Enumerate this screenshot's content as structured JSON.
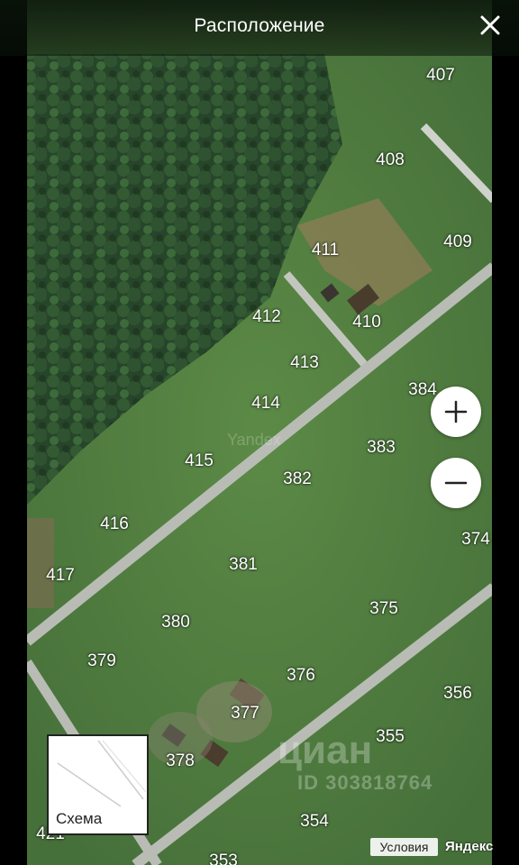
{
  "header": {
    "title": "Расположение",
    "close_icon": "close-icon"
  },
  "plots": [
    {
      "id": "p407",
      "label": "407"
    },
    {
      "id": "p408",
      "label": "408"
    },
    {
      "id": "p409",
      "label": "409"
    },
    {
      "id": "p411",
      "label": "411"
    },
    {
      "id": "p410",
      "label": "410"
    },
    {
      "id": "p412",
      "label": "412"
    },
    {
      "id": "p413",
      "label": "413"
    },
    {
      "id": "p414",
      "label": "414"
    },
    {
      "id": "p384",
      "label": "384"
    },
    {
      "id": "p383",
      "label": "383"
    },
    {
      "id": "p415",
      "label": "415"
    },
    {
      "id": "p382",
      "label": "382"
    },
    {
      "id": "p416",
      "label": "416"
    },
    {
      "id": "p374",
      "label": "374"
    },
    {
      "id": "p381",
      "label": "381"
    },
    {
      "id": "p417",
      "label": "417"
    },
    {
      "id": "p375",
      "label": "375"
    },
    {
      "id": "p380",
      "label": "380"
    },
    {
      "id": "p379",
      "label": "379"
    },
    {
      "id": "p376",
      "label": "376"
    },
    {
      "id": "p356",
      "label": "356"
    },
    {
      "id": "p377",
      "label": "377"
    },
    {
      "id": "p355",
      "label": "355"
    },
    {
      "id": "p378",
      "label": "378"
    },
    {
      "id": "p354",
      "label": "354"
    },
    {
      "id": "p421",
      "label": "421"
    },
    {
      "id": "p353",
      "label": "353"
    }
  ],
  "controls": {
    "zoom_in": "plus-icon",
    "zoom_out": "minus-icon",
    "scheme_label": "Схема",
    "terms_label": "Условия",
    "provider_logo": "Яндекс"
  },
  "watermarks": {
    "brand": "циан",
    "listing_id": "ID 303818764",
    "map_provider": "Yandex"
  },
  "colors": {
    "grass": "#4f7a3c",
    "forest": "#2b4a28",
    "road": "#b8bcb5",
    "header_bg": "#0a140a"
  }
}
